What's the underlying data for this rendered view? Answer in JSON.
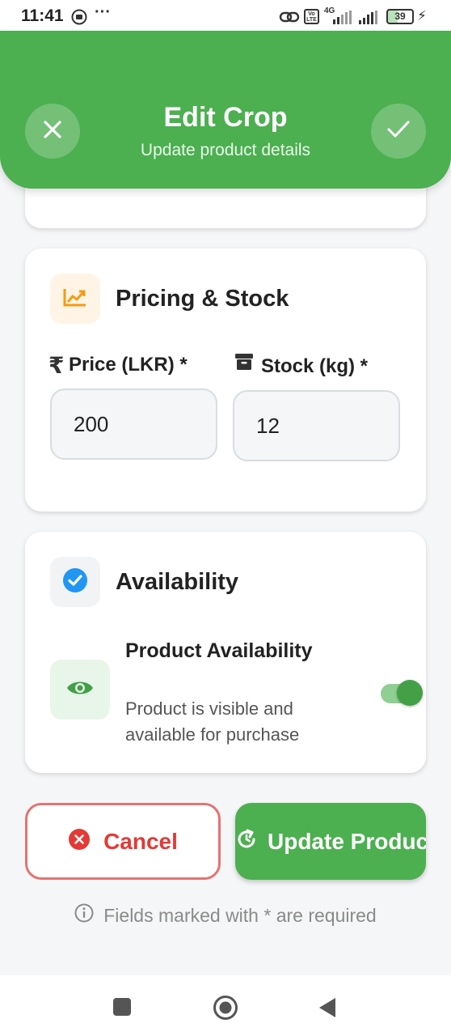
{
  "status_bar": {
    "time": "11:41",
    "battery": "39",
    "network": "4G",
    "volte": "Vo LTE"
  },
  "header": {
    "title": "Edit Crop",
    "subtitle": "Update product details",
    "close_icon": "close-icon",
    "confirm_icon": "check-icon",
    "background_color": "#4caf50"
  },
  "pricing": {
    "title": "Pricing & Stock",
    "icon": "trending-up-icon",
    "price_label": "Price (LKR) *",
    "price_value": "200",
    "stock_label": "Stock (kg) *",
    "stock_value": "12"
  },
  "availability": {
    "title": "Availability",
    "icon": "check-circle-icon",
    "item_title": "Product Availability",
    "item_description": "Product is visible and available for purchase",
    "toggle_on": true
  },
  "actions": {
    "cancel_label": "Cancel",
    "update_label": "Update Product"
  },
  "footer": {
    "note": "Fields marked with * are required"
  },
  "colors": {
    "primary": "#4caf50",
    "danger": "#e53935"
  }
}
